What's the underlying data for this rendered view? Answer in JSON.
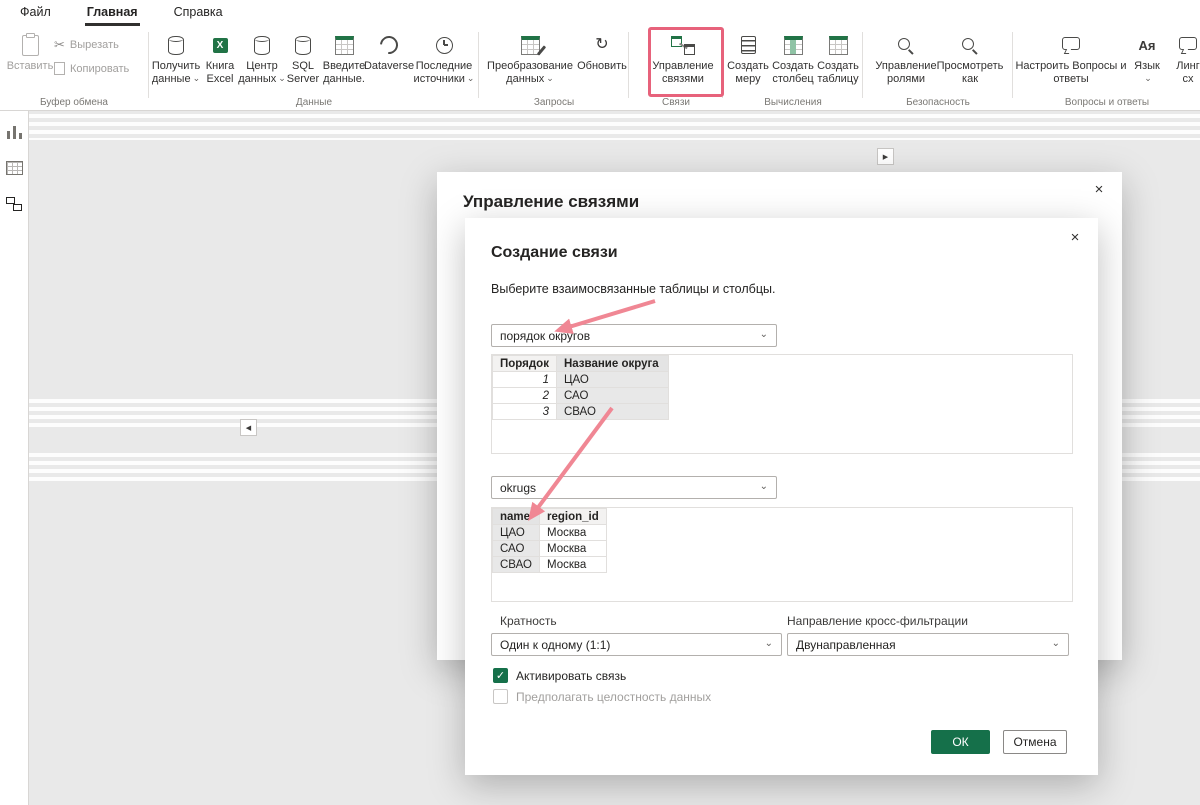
{
  "icons": {
    "chevron_down": "⌄",
    "close": "×",
    "check": "✓",
    "scissors": "✂",
    "refresh": "↻",
    "expand_right": "▶",
    "collapse_left": "◀",
    "language": "Aя",
    "excel_x": "X"
  },
  "colors": {
    "accent_green": "#15704a",
    "annotation_box": "#e7627b",
    "annotation_arrow": "#f08794"
  },
  "menubar": {
    "items": [
      "Файл",
      "Главная",
      "Справка"
    ]
  },
  "ribbon": {
    "clipboard": {
      "label": "Буфер обмена",
      "paste": "Вставить",
      "cut": "Вырезать",
      "copy": "Копировать"
    },
    "data": {
      "label": "Данные",
      "buttons": [
        {
          "l1": "Получить",
          "l2": "данные"
        },
        {
          "l1": "Книга",
          "l2": "Excel"
        },
        {
          "l1": "Центр",
          "l2": "данных"
        },
        {
          "l1": "SQL",
          "l2": "Server"
        },
        {
          "l1": "Введите",
          "l2": "данные."
        },
        {
          "l1": "Dataverse"
        },
        {
          "l1": "Последние",
          "l2": "источники"
        }
      ]
    },
    "queries": {
      "label": "Запросы",
      "transform": {
        "l1": "Преобразование",
        "l2": "данных"
      },
      "refresh": {
        "l1": "Обновить"
      }
    },
    "relationships": {
      "label": "Связи",
      "manage": {
        "l1": "Управление",
        "l2": "связями"
      }
    },
    "calculations": {
      "label": "Вычисления",
      "buttons": [
        {
          "l1": "Создать",
          "l2": "меру"
        },
        {
          "l1": "Создать",
          "l2": "столбец"
        },
        {
          "l1": "Создать",
          "l2": "таблицу"
        }
      ]
    },
    "security": {
      "label": "Безопасность",
      "roles": {
        "l1": "Управление",
        "l2": "ролями"
      },
      "view_as": {
        "l1": "Просмотреть",
        "l2": "как"
      }
    },
    "qa": {
      "label": "Вопросы и ответы",
      "setup": {
        "l1": "Настроить Вопросы и",
        "l2": "ответы"
      },
      "language": {
        "l1": "Язык"
      },
      "linguistic": {
        "l1": "Линг",
        "l2": "сх"
      }
    }
  },
  "dialog_manage": {
    "title": "Управление связями"
  },
  "dialog_create": {
    "title": "Создание связи",
    "subtitle": "Выберите взаимосвязанные таблицы и столбцы.",
    "table_selector_1": "порядок округов",
    "table1": {
      "headers": [
        "Порядок",
        "Название округа"
      ],
      "rows": [
        [
          "1",
          "ЦАО"
        ],
        [
          "2",
          "САО"
        ],
        [
          "3",
          "СВАО"
        ]
      ]
    },
    "table_selector_2": "okrugs",
    "table2": {
      "headers": [
        "name",
        "region_id"
      ],
      "rows": [
        [
          "ЦАО",
          "Москва"
        ],
        [
          "САО",
          "Москва"
        ],
        [
          "СВАО",
          "Москва"
        ]
      ]
    },
    "cardinality": {
      "label": "Кратность",
      "value": "Один к одному (1:1)"
    },
    "cross_filter": {
      "label": "Направление кросс-фильтрации",
      "value": "Двунаправленная"
    },
    "activate_checkbox": "Активировать связь",
    "integrity_checkbox": "Предполагать целостность данных",
    "ok": "ОК",
    "cancel": "Отмена"
  }
}
